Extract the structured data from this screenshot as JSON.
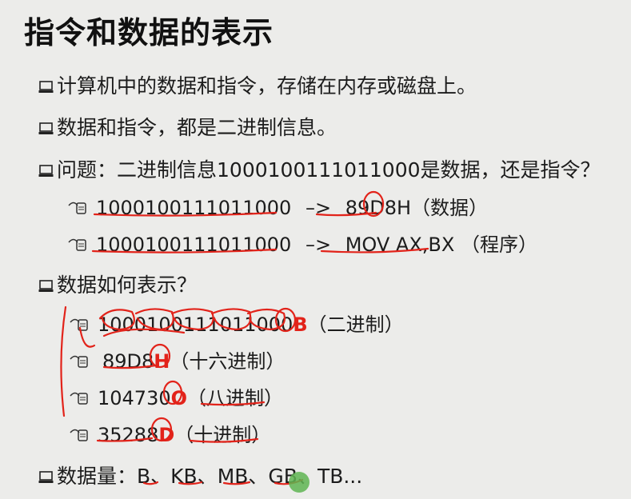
{
  "title": "指令和数据的表示",
  "bullets": {
    "b1": "计算机中的数据和指令，存储在内存或磁盘上。",
    "b2": "数据和指令，都是二进制信息。",
    "b3_prefix": "问题：二进制信息",
    "b3_binary": "1000100111011000",
    "b3_suffix": "是数据，还是指令？",
    "s1_binary": "1000100111011000",
    "s1_arrow": "–>",
    "s1_value": "89D8H",
    "s1_note": "（数据）",
    "s2_binary": "1000100111011000",
    "s2_arrow": "–>",
    "s2_value": "MOV AX,BX",
    "s2_note": "（程序）",
    "b4": "数据如何表示？",
    "r1_value": "1000100111011000",
    "r1_suffix": "B",
    "r1_note": "（二进制）",
    "r2_value": "89D8",
    "r2_suffix": "H",
    "r2_note": "（十六进制）",
    "r3_value": "104730",
    "r3_suffix": "O",
    "r3_note": "（八进制）",
    "r4_value": "35288",
    "r4_suffix": "D",
    "r4_note": "（十进制）",
    "b5": "数据量：B、KB、MB、GB、TB..."
  },
  "icons": [
    "computer-icon",
    "hand-pointer-icon"
  ],
  "colors": {
    "annotation": "#e2231a",
    "cursor_dot": "#5fb552",
    "background": "#ececea"
  }
}
